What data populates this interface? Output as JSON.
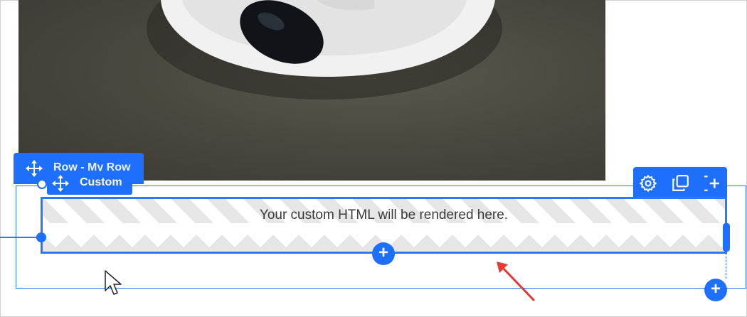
{
  "row": {
    "label": "Row - My Row"
  },
  "module": {
    "label": "Custom",
    "placeholder_text": "Your custom HTML will be rendered here."
  },
  "toolbar": {
    "settings": "settings-icon",
    "duplicate": "duplicate-icon",
    "add": "add-icon"
  },
  "colors": {
    "accent": "#1f6fff",
    "outline": "#2b78ff",
    "annotation_arrow": "#e53935"
  },
  "buttons": {
    "add_symbol": "+"
  }
}
